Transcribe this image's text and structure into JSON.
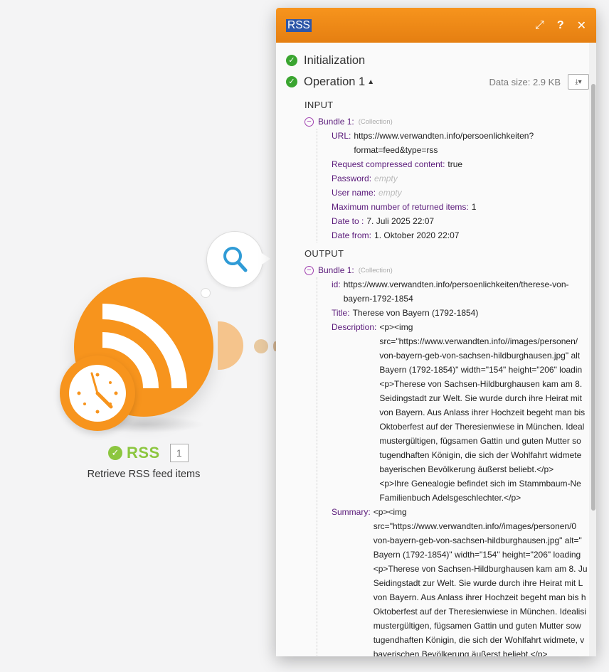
{
  "module": {
    "name": "RSS",
    "count": "1",
    "subtitle": "Retrieve RSS feed items"
  },
  "panel": {
    "title": "RSS",
    "steps": {
      "initialization": "Initialization",
      "operation": "Operation 1",
      "data_size": "Data size: 2.9 KB"
    },
    "input": {
      "heading": "INPUT",
      "bundle_label": "Bundle 1:",
      "collection_tag": "(Collection)",
      "fields": [
        {
          "key": "URL:",
          "value": "https://www.verwandten.info/persoenlichkeiten?\nformat=feed&type=rss"
        },
        {
          "key": "Request compressed content:",
          "value": "true"
        },
        {
          "key": "Password:",
          "value": "empty",
          "empty": true
        },
        {
          "key": "User name:",
          "value": "empty",
          "empty": true
        },
        {
          "key": "Maximum number of returned items:",
          "value": "1"
        },
        {
          "key": "Date to :",
          "value": "7. Juli 2025 22:07"
        },
        {
          "key": "Date from:",
          "value": "1. Oktober 2020 22:07"
        }
      ]
    },
    "output": {
      "heading": "OUTPUT",
      "bundle_label": "Bundle 1:",
      "collection_tag": "(Collection)",
      "id_key": "id:",
      "id_value": "https://www.verwandten.info/persoenlichkeiten/therese-von-\nbayern-1792-1854",
      "title_key": "Title:",
      "title_value": "Therese von Bayern (1792-1854)",
      "description_key": "Description:",
      "description_value": "<p><img\nsrc=\"https://www.verwandten.info//images/personen/\nvon-bayern-geb-von-sachsen-hildburghausen.jpg\" alt\nBayern (1792-1854)\" width=\"154\" height=\"206\" loadin\n<p>Therese von Sachsen-Hildburghausen kam am 8.\nSeidingstadt zur Welt. Sie wurde durch ihre Heirat mit\nvon Bayern. Aus Anlass ihrer Hochzeit begeht man bis\nOktoberfest auf der Theresienwiese in München. Ideal\nmustergültigen, fügsamen Gattin und guten Mutter so\ntugendhaften Königin, die sich der Wohlfahrt widmete\nbayerischen Bevölkerung äußerst beliebt.</p>\n<p>Ihre Genealogie befindet sich im Stammbaum-Ne\nFamilienbuch Adelsgeschlechter.</p>",
      "summary_key": "Summary:",
      "summary_value": "<p><img\nsrc=\"https://www.verwandten.info//images/personen/0\nvon-bayern-geb-von-sachsen-hildburghausen.jpg\" alt=\"\nBayern (1792-1854)\" width=\"154\" height=\"206\" loading\n<p>Therese von Sachsen-Hildburghausen kam am 8. Ju\nSeidingstadt zur Welt. Sie wurde durch ihre Heirat mit L\nvon Bayern. Aus Anlass ihrer Hochzeit begeht man bis h\nOktoberfest auf der Theresienwiese in München. Idealisi\nmustergültigen, fügsamen Gattin und guten Mutter sow\ntugendhaften Königin, die sich der Wohlfahrt widmete, v\nbayerischen Bevölkerung äußerst beliebt.</p>"
    }
  },
  "colors": {
    "accent": "#f7941d",
    "success": "#3aa530",
    "module_ok": "#8cc63f",
    "key_purple": "#5a1a7a"
  }
}
